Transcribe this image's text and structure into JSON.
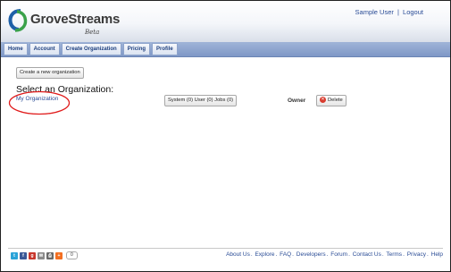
{
  "header": {
    "brand": "GroveStreams",
    "beta": "Beta",
    "user_link": "Sample User",
    "separator": "|",
    "logout_link": "Logout"
  },
  "nav": {
    "items": [
      "Home",
      "Account",
      "Create Organization",
      "Pricing",
      "Profile"
    ]
  },
  "main": {
    "create_button": "Create a new organization",
    "heading": "Select an Organization:",
    "org_name": "My Organization",
    "stats_button": "System (0) User (0) Jobs (0)",
    "owner_label": "Owner",
    "delete_button": "Delete",
    "highlight_color": "#e01a1a"
  },
  "footer": {
    "social_icons": [
      "twitter-icon",
      "facebook-icon",
      "google-plus-icon",
      "email-icon",
      "print-icon",
      "share-icon"
    ],
    "share_count": "0",
    "links": [
      "About Us",
      "Explore",
      "FAQ",
      "Developers",
      "Forum",
      "Contact Us",
      "Terms",
      "Privacy",
      "Help"
    ],
    "link_separator": "."
  }
}
